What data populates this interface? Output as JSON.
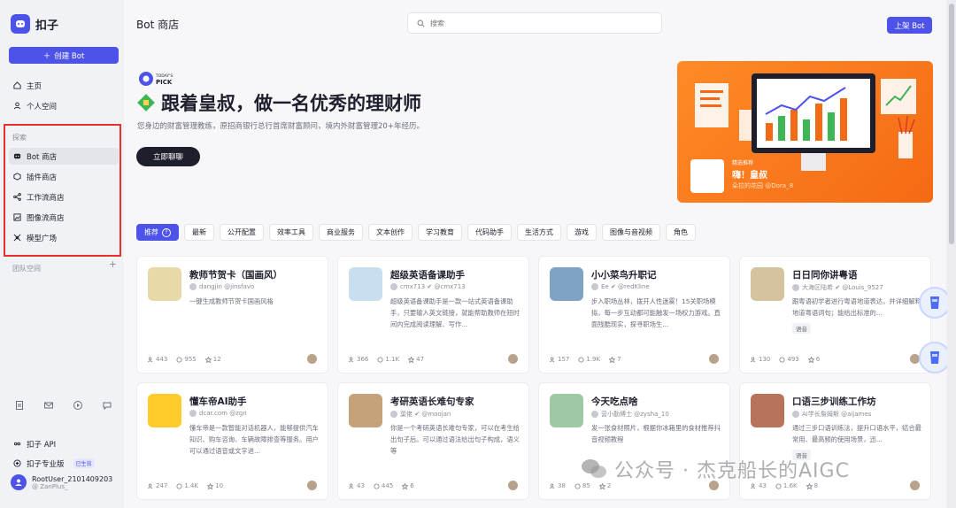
{
  "app": {
    "name": "扣子",
    "create_label": "创建 Bot"
  },
  "sidebar": {
    "top_items": [
      {
        "label": "主页",
        "icon": "home-icon"
      },
      {
        "label": "个人空间",
        "icon": "user-icon"
      }
    ],
    "explore_label": "探索",
    "explore_items": [
      {
        "label": "Bot 商店",
        "icon": "bot-icon",
        "active": true
      },
      {
        "label": "插件商店",
        "icon": "plugin-icon"
      },
      {
        "label": "工作流商店",
        "icon": "workflow-icon"
      },
      {
        "label": "图像流商店",
        "icon": "image-flow-icon"
      },
      {
        "label": "模型广场",
        "icon": "model-icon"
      }
    ],
    "team_label": "团队空间",
    "bottom_items": [
      {
        "label": "扣子 API",
        "icon": "api-icon"
      },
      {
        "label": "扣子专业版",
        "badge": "已生效",
        "icon": "pro-icon"
      }
    ],
    "user": {
      "name": "RootUser_2101409203",
      "handle": "@ ZanPlus_"
    }
  },
  "header": {
    "title": "Bot 商店",
    "search_placeholder": "搜索",
    "publish_label": "上架 Bot"
  },
  "hero": {
    "badge_line1": "TODAY'S",
    "badge_line2": "PICK",
    "title": "跟着皇叔，做一名优秀的理财师",
    "subtitle": "您身边的财富管理教练，原招商银行总行首席财富顾问，境内外财富管理20+年经历。",
    "cta_label": "立即聊聊",
    "banner_tag": "精选推荐",
    "banner_name": "嗨！皇叔",
    "banner_creator": "朵拉的花园  @Dora_8"
  },
  "tabs": [
    {
      "label": "推荐",
      "active": true,
      "help": "?"
    },
    {
      "label": "最新"
    },
    {
      "label": "公开配置"
    },
    {
      "label": "效率工具"
    },
    {
      "label": "商业服务"
    },
    {
      "label": "文本创作"
    },
    {
      "label": "学习教育"
    },
    {
      "label": "代码助手"
    },
    {
      "label": "生活方式"
    },
    {
      "label": "游戏"
    },
    {
      "label": "图像与音视频"
    },
    {
      "label": "角色"
    }
  ],
  "cards": [
    {
      "title": "教师节贺卡（国画风）",
      "author": "dangjin @jinsfavo",
      "desc": "一键生成教师节贺卡国画风格",
      "tag": "",
      "users": "443",
      "chats": "955",
      "stars": "12",
      "icon_color": "#e8d9a8"
    },
    {
      "title": "超级英语备课助手",
      "author": "cmx713 ✔ @cmx713",
      "desc": "超级英语备课助手是一款一站式英语备课助手，只要输入英文链接，就能帮助教师在短时间内完成阅读理解、写作...",
      "tag": "",
      "users": "366",
      "chats": "1.1K",
      "stars": "47",
      "icon_color": "#c9dfef"
    },
    {
      "title": "小小菜鸟升职记",
      "author": "Ee ✔ @redKline",
      "desc": "步入职场丛林，拨开人性迷雾！15关职场模拟，每一步互动都可能触发一场权力游戏。直面残酷现实，探寻职场生...",
      "tag": "",
      "users": "157",
      "chats": "1.9K",
      "stars": "7",
      "icon_color": "#7fa3c4"
    },
    {
      "title": "日日同你讲粤语",
      "author": "大海区陆希 ✔ @Louis_9527",
      "desc": "跟粤语初学者进行粤语地道表达，并详细解释地道粤语词句；能给出标准的...",
      "tag": "语音",
      "users": "130",
      "chats": "493",
      "stars": "6",
      "icon_color": "#d5c3a0"
    },
    {
      "title": "懂车帝AI助手",
      "author": "dcar.com @zgn",
      "desc": "懂车帝是一款智能对话机器人，能够提供汽车知识、购车咨询、车辆故障排查等服务。用户可以通过语音或文字进...",
      "tag": "",
      "users": "247",
      "chats": "1.4K",
      "stars": "10",
      "icon_color": "#ffcc2a"
    },
    {
      "title": "考研英语长难句专家",
      "author": "葉佬 ✔ @moojan",
      "desc": "你是一个考研英语长难句专家，可以在考生给出句子后。可以通过语法给出句子构成，语义等",
      "tag": "",
      "users": "43",
      "chats": "445",
      "stars": "6",
      "icon_color": "#c6a27a"
    },
    {
      "title": "今天吃点啥",
      "author": "营小勤博士 @zysha_10",
      "desc": "发一张食材照片，根据你冰箱里的食材推荐抖音视频教程",
      "tag": "",
      "users": "38",
      "chats": "85",
      "stars": "2",
      "icon_color": "#9fc9a6"
    },
    {
      "title": "口语三步训练工作坊",
      "author": "AI学长詹姆斯 @aijames",
      "desc": "通过三步口语训练法，提升口语水平，结合最常用、最高频的使用场景，迅...",
      "tag": "语音",
      "users": "43",
      "chats": "1.6K",
      "stars": "8",
      "icon_color": "#b8745a"
    }
  ],
  "watermark": "公众号 · 杰克船长的AIGC",
  "colors": {
    "accent": "#4d53e8",
    "highlight_border": "#e8302c",
    "banner": "#f46a14"
  }
}
